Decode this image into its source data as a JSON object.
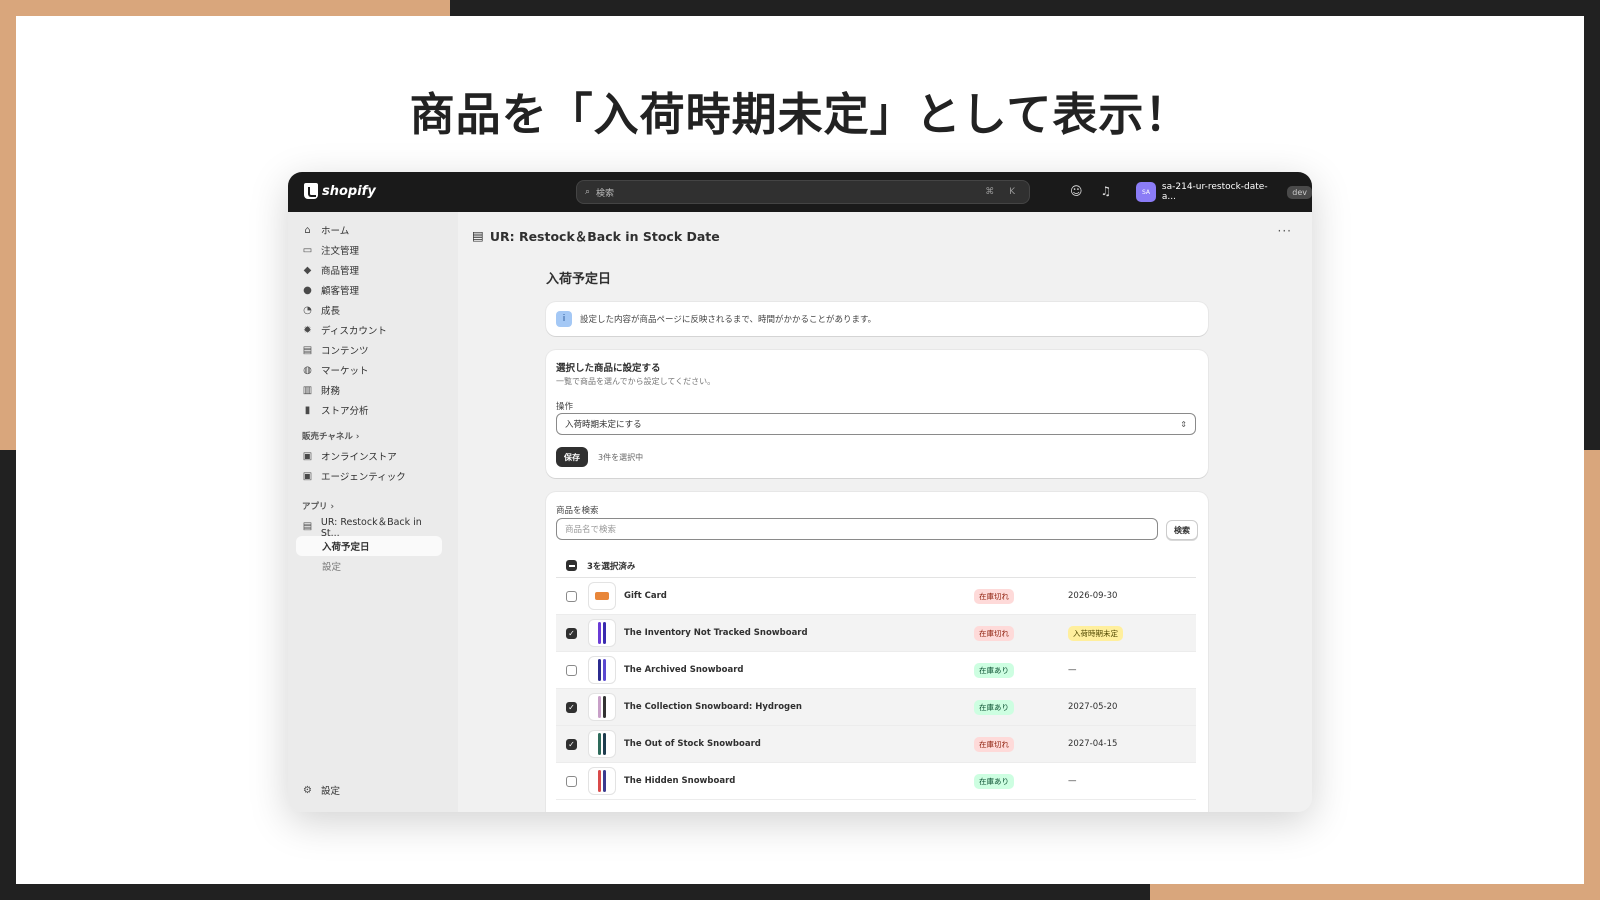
{
  "headline": "商品を「入荷時期未定」として表示！",
  "topbar": {
    "logo_text": "shopify",
    "search_placeholder": "検索",
    "search_shortcut": "⌘ K",
    "store_avatar": "SA",
    "store_name": "sa-214-ur-restock-date-a...",
    "store_badge": "dev"
  },
  "sidebar": {
    "items": [
      {
        "label": "ホーム",
        "icon": "home-icon"
      },
      {
        "label": "注文管理",
        "icon": "inbox-icon"
      },
      {
        "label": "商品管理",
        "icon": "tag-icon"
      },
      {
        "label": "顧客管理",
        "icon": "person-icon"
      },
      {
        "label": "成長",
        "icon": "gauge-icon"
      },
      {
        "label": "ディスカウント",
        "icon": "discount-icon"
      },
      {
        "label": "コンテンツ",
        "icon": "content-icon"
      },
      {
        "label": "マーケット",
        "icon": "globe-icon"
      },
      {
        "label": "財務",
        "icon": "bank-icon"
      },
      {
        "label": "ストア分析",
        "icon": "chart-icon"
      }
    ],
    "sales_channels_label": "販売チャネル",
    "channels": [
      {
        "label": "オンラインストア",
        "icon": "store-icon"
      },
      {
        "label": "エージェンティック",
        "icon": "agent-icon"
      }
    ],
    "apps_label": "アプリ",
    "app_name": "UR: Restock＆Back in St...",
    "app_sub_active": "入荷予定日",
    "app_sub_settings": "設定",
    "settings_label": "設定"
  },
  "main": {
    "page_title": "UR: Restock＆Back in Stock Date",
    "section_title": "入荷予定日",
    "banner_text": "設定した内容が商品ページに反映されるまで、時間がかかることがあります。",
    "bulk": {
      "title": "選択した商品に設定する",
      "subtitle": "一覧で商品を選んでから設定してください。",
      "operation_label": "操作",
      "operation_value": "入荷時期未定にする",
      "save_label": "保存",
      "selected_note": "3件を選択中"
    },
    "list": {
      "search_label": "商品を検索",
      "search_placeholder": "商品名で検索",
      "search_button": "検索",
      "selected_header": "3を選択済み",
      "products": [
        {
          "name": "Gift Card",
          "stock": "在庫切れ",
          "date": "2026-09-30",
          "checked": false
        },
        {
          "name": "The Inventory Not Tracked Snowboard",
          "stock": "在庫切れ",
          "date": "入荷時期未定",
          "checked": true
        },
        {
          "name": "The Archived Snowboard",
          "stock": "在庫あり",
          "date": "—",
          "checked": false
        },
        {
          "name": "The Collection Snowboard: Hydrogen",
          "stock": "在庫あり",
          "date": "2027-05-20",
          "checked": true
        },
        {
          "name": "The Out of Stock Snowboard",
          "stock": "在庫切れ",
          "date": "2027-04-15",
          "checked": true
        },
        {
          "name": "The Hidden Snowboard",
          "stock": "在庫あり",
          "date": "—",
          "checked": false
        }
      ]
    }
  },
  "colors": {
    "accent_orange": "#D9A67C",
    "dark_bg": "#212121",
    "out_of_stock_bg": "#fedad9",
    "in_stock_bg": "#cdfee1",
    "tbd_bg": "#ffef9d"
  }
}
